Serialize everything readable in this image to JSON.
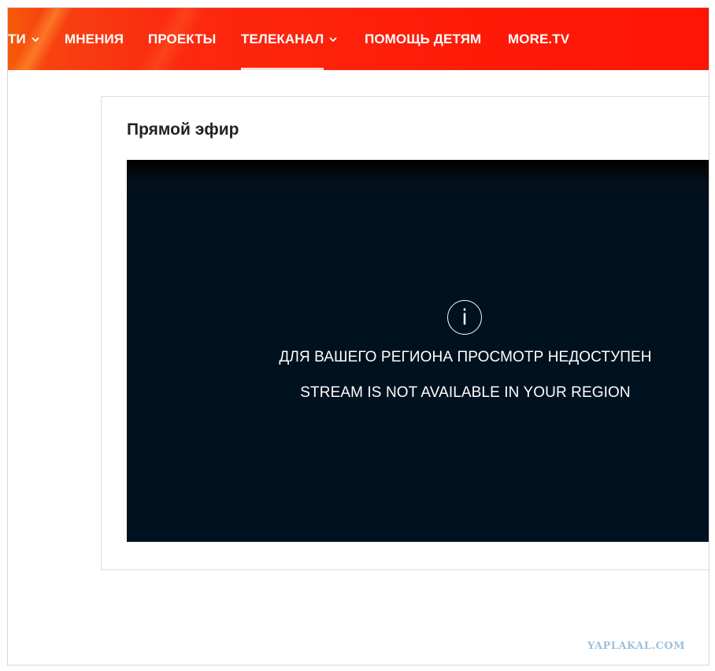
{
  "nav": {
    "items": [
      {
        "label": "ТИ",
        "has_dropdown": true
      },
      {
        "label": "МНЕНИЯ",
        "has_dropdown": false
      },
      {
        "label": "ПРОЕКТЫ",
        "has_dropdown": false
      },
      {
        "label": "ТЕЛЕКАНАЛ",
        "has_dropdown": true,
        "active": true
      },
      {
        "label": "ПОМОЩЬ ДЕТЯМ",
        "has_dropdown": false
      },
      {
        "label": "MORE.TV",
        "has_dropdown": false
      }
    ],
    "colors": {
      "bar": "#ff1a08",
      "bar_left": "#f55c0a",
      "text": "#ffffff"
    },
    "chevron_icon": "chevron-down-icon"
  },
  "live": {
    "title": "Прямой эфир",
    "player": {
      "background": "#00111f",
      "info_icon": "info-icon",
      "info_glyph": "i",
      "message_ru": "ДЛЯ ВАШЕГО РЕГИОНА ПРОСМОТР НЕДОСТУПЕН",
      "message_en": "STREAM IS NOT AVAILABLE IN YOUR REGION"
    }
  },
  "watermark": {
    "text": "YAPLAKAL.COM",
    "color": "#9ec2da"
  }
}
